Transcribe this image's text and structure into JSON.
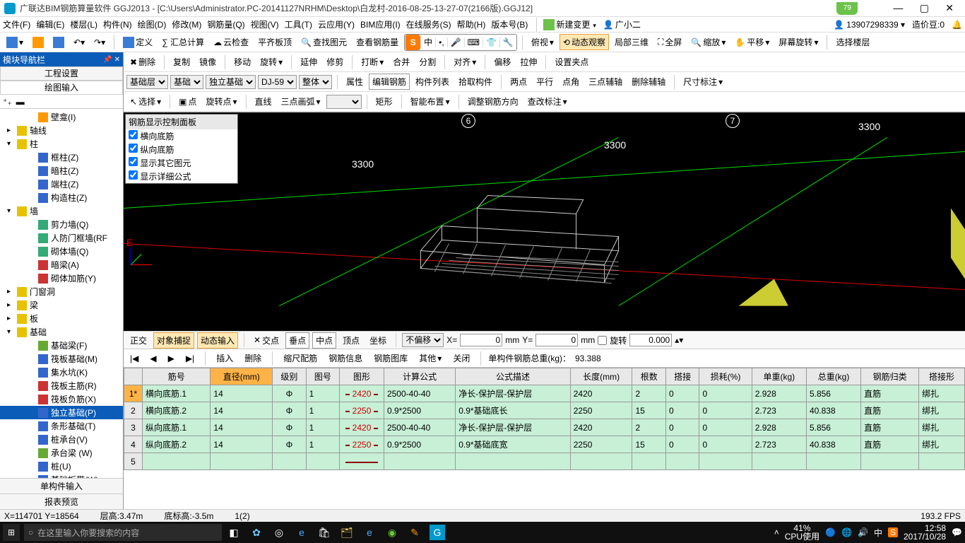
{
  "title": "广联达BIM钢筋算量软件 GGJ2013 - [C:\\Users\\Administrator.PC-20141127NRHM\\Desktop\\白龙村-2016-08-25-13-27-07(2166版).GGJ12]",
  "title_badge": "79",
  "menubar": {
    "items": [
      "文件(F)",
      "编辑(E)",
      "楼层(L)",
      "构件(N)",
      "绘图(D)",
      "修改(M)",
      "钢筋量(Q)",
      "视图(V)",
      "工具(T)",
      "云应用(Y)",
      "BIM应用(I)",
      "在线服务(S)",
      "帮助(H)",
      "版本号(B)"
    ],
    "new_change": "新建变更",
    "assistant": "广小二",
    "phone": "13907298339",
    "credit_label": "造价豆:0"
  },
  "toolbar1": {
    "define": "定义",
    "sumcalc": "∑ 汇总计算",
    "cloudcheck": "云检查",
    "flatroof": "平齐板顶",
    "findgraph": "查找图元",
    "viewsteel": "查看钢筋量",
    "overlook": "俯视",
    "dynamic": "动态观察",
    "local3d": "局部三维",
    "fullscreen": "全屏",
    "zoom": "缩放",
    "pan": "平移",
    "screenrotate": "屏幕旋转",
    "selectfloor": "选择楼层"
  },
  "toolbar2": {
    "delete": "删除",
    "copy": "复制",
    "mirror": "镜像",
    "move": "移动",
    "rotate": "旋转",
    "extend": "延伸",
    "trim": "修剪",
    "break": "打断",
    "merge": "合并",
    "split": "分割",
    "align": "对齐",
    "offset": "偏移",
    "stretch": "拉伸",
    "setpoint": "设置夹点"
  },
  "toolbar3": {
    "layer": "基础层",
    "cat": "基础",
    "type": "独立基础",
    "comp": "DJ-59",
    "mode": "整体",
    "attr": "属性",
    "editsteel": "编辑钢筋",
    "complist": "构件列表",
    "pickcomp": "拾取构件",
    "two": "两点",
    "parallel": "平行",
    "angle": "点角",
    "threeaux": "三点辅轴",
    "delaux": "删除辅轴",
    "dimlabel": "尺寸标注"
  },
  "toolbar4": {
    "select": "选择",
    "point": "点",
    "rotpoint": "旋转点",
    "line": "直线",
    "arc3": "三点画弧",
    "rect": "矩形",
    "smart": "智能布置",
    "adjustdir": "调整钢筋方向",
    "checknote": "查改标注"
  },
  "left_panel": {
    "title": "模块导航栏",
    "tab1": "工程设置",
    "tab2": "绘图输入",
    "tree": [
      {
        "l": 3,
        "label": "壁龛(I)",
        "ico": "#f90"
      },
      {
        "l": 1,
        "label": "轴线",
        "tw": "▸",
        "ico": "#e6c200"
      },
      {
        "l": 1,
        "label": "柱",
        "tw": "▾",
        "ico": "#e6c200"
      },
      {
        "l": 3,
        "label": "框柱(Z)",
        "ico": "#36c"
      },
      {
        "l": 3,
        "label": "暗柱(Z)",
        "ico": "#36c"
      },
      {
        "l": 3,
        "label": "端柱(Z)",
        "ico": "#36c"
      },
      {
        "l": 3,
        "label": "构造柱(Z)",
        "ico": "#36c"
      },
      {
        "l": 1,
        "label": "墙",
        "tw": "▾",
        "ico": "#e6c200"
      },
      {
        "l": 3,
        "label": "剪力墙(Q)",
        "ico": "#3a7"
      },
      {
        "l": 3,
        "label": "人防门框墙(RF",
        "ico": "#3a7"
      },
      {
        "l": 3,
        "label": "砌体墙(Q)",
        "ico": "#3a7"
      },
      {
        "l": 3,
        "label": "暗梁(A)",
        "ico": "#c33"
      },
      {
        "l": 3,
        "label": "砌体加筋(Y)",
        "ico": "#c33"
      },
      {
        "l": 1,
        "label": "门窗洞",
        "tw": "▸",
        "ico": "#e6c200"
      },
      {
        "l": 1,
        "label": "梁",
        "tw": "▸",
        "ico": "#e6c200"
      },
      {
        "l": 1,
        "label": "板",
        "tw": "▸",
        "ico": "#e6c200"
      },
      {
        "l": 1,
        "label": "基础",
        "tw": "▾",
        "ico": "#e6c200"
      },
      {
        "l": 3,
        "label": "基础梁(F)",
        "ico": "#6a3"
      },
      {
        "l": 3,
        "label": "筏板基础(M)",
        "ico": "#36c"
      },
      {
        "l": 3,
        "label": "集水坑(K)",
        "ico": "#36c"
      },
      {
        "l": 3,
        "label": "筏板主筋(R)",
        "ico": "#c33"
      },
      {
        "l": 3,
        "label": "筏板负筋(X)",
        "ico": "#c33"
      },
      {
        "l": 3,
        "label": "独立基础(P)",
        "ico": "#36c",
        "selected": true
      },
      {
        "l": 3,
        "label": "条形基础(T)",
        "ico": "#36c"
      },
      {
        "l": 3,
        "label": "桩承台(V)",
        "ico": "#36c"
      },
      {
        "l": 3,
        "label": "承台梁 (W)",
        "ico": "#6a3"
      },
      {
        "l": 3,
        "label": "桩(U)",
        "ico": "#36c"
      },
      {
        "l": 3,
        "label": "基础板带(W)",
        "ico": "#36c"
      }
    ],
    "bottom1": "单构件输入",
    "bottom2": "报表预览"
  },
  "float_panel": {
    "title": "钢筋显示控制面板",
    "items": [
      "横向底筋",
      "纵向底筋",
      "显示其它图元",
      "显示详细公式"
    ]
  },
  "viewport_labels": {
    "a6": "6",
    "a7": "7",
    "d3300a": "3300",
    "d3300b": "3300",
    "d3300c": "3300",
    "aE": "E"
  },
  "ime": {
    "logo": "S",
    "lang": "中"
  },
  "snapbar": {
    "ortho": "正交",
    "osnap": "对象捕捉",
    "dyninput": "动态输入",
    "cross": "交点",
    "perp": "垂点",
    "mid": "中点",
    "vertex": "顶点",
    "coord": "坐标",
    "nooffset": "不偏移",
    "xlabel": "X=",
    "xval": "0",
    "xmm": "mm",
    "ylabel": "Y=",
    "yval": "0",
    "ymm": "mm",
    "rot": "旋转",
    "rotval": "0.000"
  },
  "tabletools": {
    "insert": "插入",
    "delete": "删除",
    "scale": "缩尺配筋",
    "steelinfo": "钢筋信息",
    "steellib": "钢筋图库",
    "other": "其他",
    "close": "关闭",
    "total_label": "单构件钢筋总重(kg)：",
    "total_val": "93.388"
  },
  "table": {
    "headers": [
      "",
      "筋号",
      "直径(mm)",
      "级别",
      "图号",
      "图形",
      "计算公式",
      "公式描述",
      "长度(mm)",
      "根数",
      "搭接",
      "损耗(%)",
      "单重(kg)",
      "总重(kg)",
      "钢筋归类",
      "搭接形"
    ],
    "highlight_header": "直径(mm)",
    "rows": [
      {
        "n": "1*",
        "sel": true,
        "num": "横向底筋.1",
        "dia": "14",
        "lvl": "Φ",
        "fig": "1",
        "dim": "2420",
        "formula": "2500-40-40",
        "desc": "净长-保护层-保护层",
        "len": "2420",
        "qty": "2",
        "lap": "0",
        "loss": "0",
        "uw": "2.928",
        "tw": "5.856",
        "cat": "直筋",
        "jt": "绑扎"
      },
      {
        "n": "2",
        "num": "横向底筋.2",
        "dia": "14",
        "lvl": "Φ",
        "fig": "1",
        "dim": "2250",
        "formula": "0.9*2500",
        "desc": "0.9*基础底长",
        "len": "2250",
        "qty": "15",
        "lap": "0",
        "loss": "0",
        "uw": "2.723",
        "tw": "40.838",
        "cat": "直筋",
        "jt": "绑扎"
      },
      {
        "n": "3",
        "num": "纵向底筋.1",
        "dia": "14",
        "lvl": "Φ",
        "fig": "1",
        "dim": "2420",
        "formula": "2500-40-40",
        "desc": "净长-保护层-保护层",
        "len": "2420",
        "qty": "2",
        "lap": "0",
        "loss": "0",
        "uw": "2.928",
        "tw": "5.856",
        "cat": "直筋",
        "jt": "绑扎"
      },
      {
        "n": "4",
        "num": "纵向底筋.2",
        "dia": "14",
        "lvl": "Φ",
        "fig": "1",
        "dim": "2250",
        "formula": "0.9*2500",
        "desc": "0.9*基础底宽",
        "len": "2250",
        "qty": "15",
        "lap": "0",
        "loss": "0",
        "uw": "2.723",
        "tw": "40.838",
        "cat": "直筋",
        "jt": "绑扎"
      },
      {
        "n": "5"
      }
    ]
  },
  "statusbar": {
    "xy": "X=114701 Y=18564",
    "floor": "层高:3.47m",
    "bottom": "底标高:-3.5m",
    "sel": "1(2)",
    "fps": "193.2 FPS"
  },
  "taskbar": {
    "search_placeholder": "在这里输入你要搜索的内容",
    "cpu_pct": "41%",
    "cpu_lbl": "CPU使用",
    "lang": "中",
    "time": "12:58",
    "date": "2017/10/28"
  }
}
